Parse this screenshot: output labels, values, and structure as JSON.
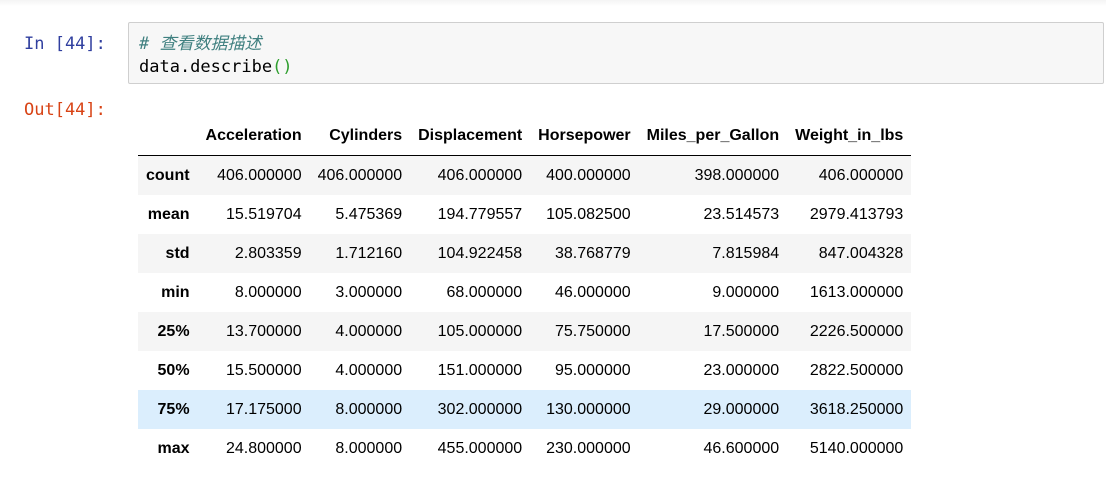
{
  "input_cell": {
    "prompt": "In [44]:",
    "code_comment": "# 查看数据描述",
    "code_call": "data.describe",
    "code_parens": "()"
  },
  "output_cell": {
    "prompt": "Out[44]:"
  },
  "table": {
    "columns": [
      "Acceleration",
      "Cylinders",
      "Displacement",
      "Horsepower",
      "Miles_per_Gallon",
      "Weight_in_lbs"
    ],
    "rows": [
      {
        "index": "count",
        "values": [
          "406.000000",
          "406.000000",
          "406.000000",
          "400.000000",
          "398.000000",
          "406.000000"
        ]
      },
      {
        "index": "mean",
        "values": [
          "15.519704",
          "5.475369",
          "194.779557",
          "105.082500",
          "23.514573",
          "2979.413793"
        ]
      },
      {
        "index": "std",
        "values": [
          "2.803359",
          "1.712160",
          "104.922458",
          "38.768779",
          "7.815984",
          "847.004328"
        ]
      },
      {
        "index": "min",
        "values": [
          "8.000000",
          "3.000000",
          "68.000000",
          "46.000000",
          "9.000000",
          "1613.000000"
        ]
      },
      {
        "index": "25%",
        "values": [
          "13.700000",
          "4.000000",
          "105.000000",
          "75.750000",
          "17.500000",
          "2226.500000"
        ]
      },
      {
        "index": "50%",
        "values": [
          "15.500000",
          "4.000000",
          "151.000000",
          "95.000000",
          "23.000000",
          "2822.500000"
        ]
      },
      {
        "index": "75%",
        "values": [
          "17.175000",
          "8.000000",
          "302.000000",
          "130.000000",
          "29.000000",
          "3618.250000"
        ]
      },
      {
        "index": "max",
        "values": [
          "24.800000",
          "8.000000",
          "455.000000",
          "230.000000",
          "46.600000",
          "5140.000000"
        ]
      }
    ],
    "highlighted_row_index": "75%"
  },
  "colors": {
    "in_prompt": "#303f9f",
    "out_prompt": "#d84315",
    "comment": "#408080",
    "parens": "#2e9e2e",
    "input_background": "#f7f7f7",
    "row_stripe": "#f5f5f5",
    "row_hover": "#dbeefd"
  }
}
